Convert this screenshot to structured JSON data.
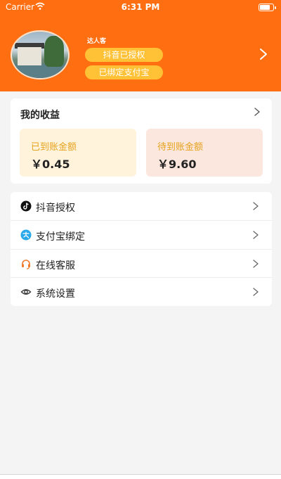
{
  "status_bar": {
    "carrier": "Carrier",
    "time": "6:31 PM"
  },
  "profile": {
    "nickname": "达人客",
    "douyin_badge": "抖音已授权",
    "alipay_badge": "已绑定支付宝"
  },
  "earnings": {
    "title": "我的收益",
    "received_label": "已到账金额",
    "received_amount": "￥0.45",
    "pending_label": "待到账金额",
    "pending_amount": "￥9.60"
  },
  "menu": [
    {
      "label": "抖音授权",
      "icon": "douyin-icon"
    },
    {
      "label": "支付宝绑定",
      "icon": "alipay-icon"
    },
    {
      "label": "在线客服",
      "icon": "headset-icon"
    },
    {
      "label": "系统设置",
      "icon": "eye-settings-icon"
    }
  ],
  "colors": {
    "brand": "#ff6f12",
    "badge": "#ffc236",
    "accent_text": "#e7a21d"
  }
}
